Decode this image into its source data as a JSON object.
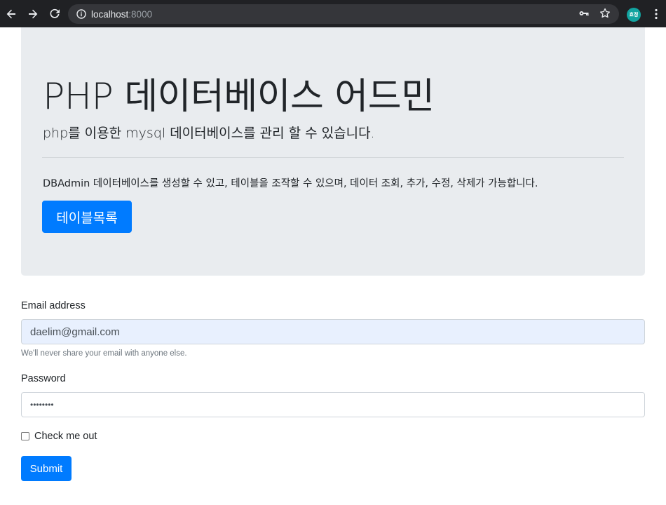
{
  "browser": {
    "url_host": "localhost",
    "url_port": ":8000",
    "profile_initials": "효정",
    "icons": [
      "back-arrow-icon",
      "forward-arrow-icon",
      "reload-icon",
      "info-icon",
      "key-icon",
      "star-icon",
      "menu-dots-icon"
    ]
  },
  "jumbotron": {
    "title": "PHP 데이터베이스 어드민",
    "lead": "php를 이용한 mysql 데이터베이스를 관리 할 수 있습니다.",
    "text": "DBAdmin 데이터베이스를 생성할 수 있고, 테이블을 조작할 수 있으며, 데이터 조회, 추가, 수정, 삭제가 가능합니다.",
    "button_label": "테이블목록"
  },
  "form": {
    "email_label": "Email address",
    "email_value": "daelim@gmail.com",
    "email_help": "We'll never share your email with anyone else.",
    "password_label": "Password",
    "password_value": "••••••••",
    "checkbox_label": "Check me out",
    "submit_label": "Submit"
  },
  "colors": {
    "primary": "#007bff",
    "jumbotron_bg": "#e9ecef",
    "chrome_bg": "#202124",
    "autofill_bg": "#e8f0fe"
  }
}
